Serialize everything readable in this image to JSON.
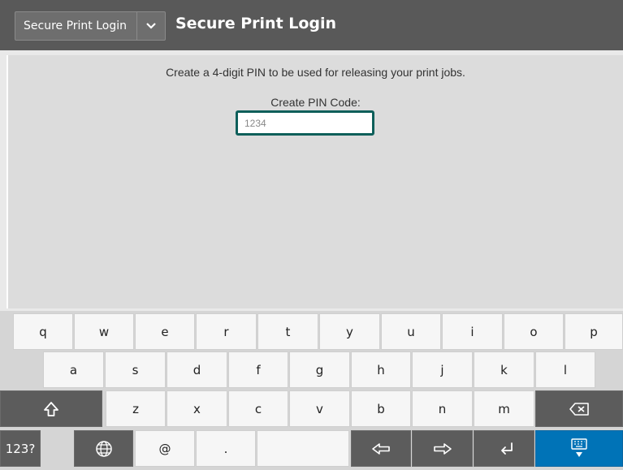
{
  "header": {
    "app_selector_label": "Secure Print Login",
    "title": "Secure Print Login"
  },
  "main": {
    "instruction": "Create a 4-digit PIN to be used for releasing your print jobs.",
    "pin_label": "Create PIN Code:",
    "pin_placeholder": "1234",
    "pin_value": ""
  },
  "keyboard": {
    "row1": [
      "q",
      "w",
      "e",
      "r",
      "t",
      "y",
      "u",
      "i",
      "o",
      "p"
    ],
    "row2": [
      "a",
      "s",
      "d",
      "f",
      "g",
      "h",
      "j",
      "k",
      "l"
    ],
    "row3": [
      "z",
      "x",
      "c",
      "v",
      "b",
      "n",
      "m"
    ],
    "numeric_label": "123?",
    "at_label": "@",
    "period_label": ".",
    "icons": [
      "shift-icon",
      "backspace-icon",
      "globe-icon",
      "arrow-left-icon",
      "arrow-right-icon",
      "enter-icon",
      "hide-keyboard-icon"
    ]
  },
  "colors": {
    "header_bg": "#595959",
    "content_bg": "#dcdcdc",
    "input_border": "#0e5f5a",
    "key_dark": "#5c5c5c",
    "key_blue": "#0073b7"
  }
}
